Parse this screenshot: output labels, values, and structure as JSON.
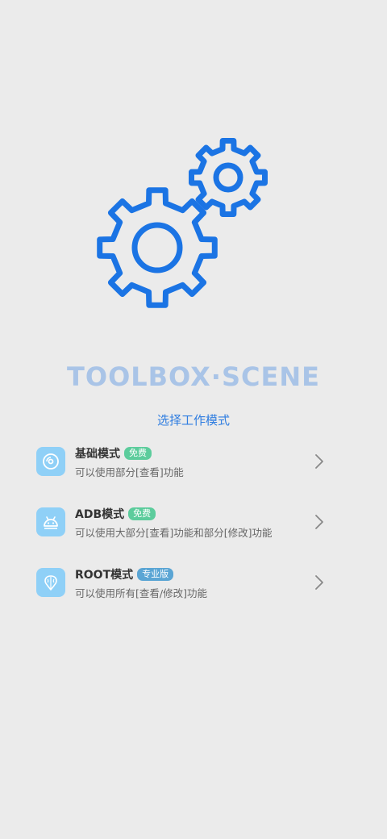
{
  "app": {
    "title": "TOOLBOX·SCENE",
    "subtitle": "选择工作模式",
    "accent_color": "#2f7de0",
    "title_color": "#a9c4e7",
    "logo_icon": "gears-icon"
  },
  "modes": [
    {
      "name": "基础模式",
      "badge": "免费",
      "badge_color": "#5ccc9c",
      "description": "可以使用部分[查看]功能",
      "icon": "disc-icon"
    },
    {
      "name": "ADB模式",
      "badge": "免费",
      "badge_color": "#5ccc9c",
      "description": "可以使用大部分[查看]功能和部分[修改]功能",
      "icon": "android-icon"
    },
    {
      "name": "ROOT模式",
      "badge": "专业版",
      "badge_color": "#5aa5d4",
      "description": "可以使用所有[查看/修改]功能",
      "icon": "brain-icon"
    }
  ]
}
